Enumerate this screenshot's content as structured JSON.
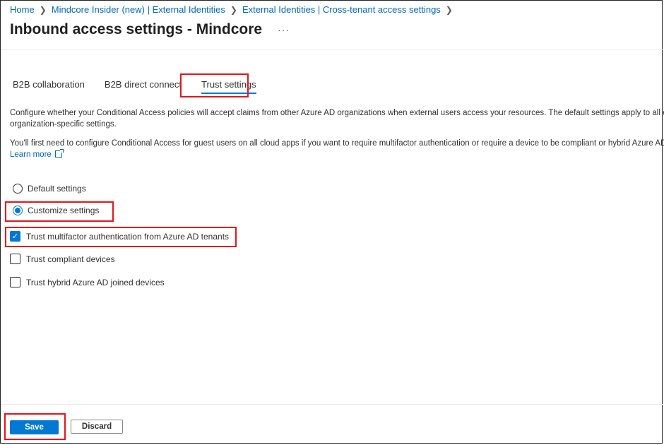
{
  "breadcrumb": {
    "items": [
      "Home",
      "Mindcore Insider (new) | External Identities",
      "External Identities | Cross-tenant access settings"
    ],
    "separator": ">"
  },
  "page": {
    "title": "Inbound access settings - Mindcore",
    "more_label": "···"
  },
  "tabs": [
    {
      "label": "B2B collaboration",
      "active": false
    },
    {
      "label": "B2B direct connect",
      "active": false
    },
    {
      "label": "Trust settings",
      "active": true
    }
  ],
  "description": {
    "line1": "Configure whether your Conditional Access policies will accept claims from other Azure AD organizations when external users access your resources. The default settings apply to all externa",
    "line2": "organization-specific settings.",
    "line3": "You'll first need to configure Conditional Access for guest users on all cloud apps if you want to require multifactor authentication or require a device to be compliant or hybrid Azure AD joi",
    "learn_more": "Learn more"
  },
  "settings_mode": {
    "options": [
      {
        "label": "Default settings",
        "selected": false
      },
      {
        "label": "Customize settings",
        "selected": true
      }
    ]
  },
  "trust_options": [
    {
      "label": "Trust multifactor authentication from Azure AD tenants",
      "checked": true
    },
    {
      "label": "Trust compliant devices",
      "checked": false
    },
    {
      "label": "Trust hybrid Azure AD joined devices",
      "checked": false
    }
  ],
  "footer": {
    "save_label": "Save",
    "discard_label": "Discard"
  },
  "colors": {
    "accent": "#0078d4",
    "link": "#0067b8",
    "highlight": "#e8131a"
  }
}
